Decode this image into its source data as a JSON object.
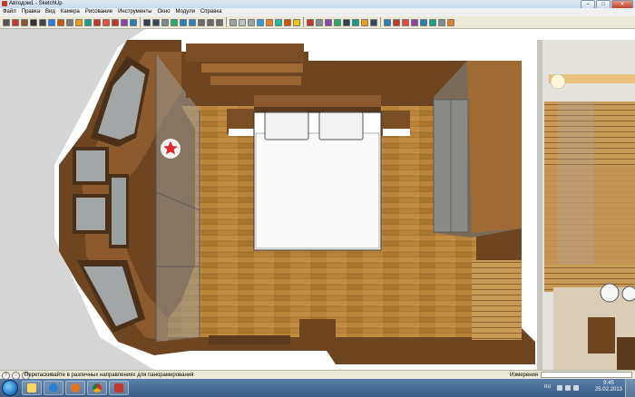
{
  "window": {
    "title": "Автодом1 - SketchUp"
  },
  "menu": [
    "Файл",
    "Правка",
    "Вид",
    "Камера",
    "Рисование",
    "Инструменты",
    "Окно",
    "Модули",
    "Справка"
  ],
  "toolbar": {
    "tools": [
      "select",
      "pencil",
      "rectangle",
      "circle",
      "arc",
      "make-component",
      "eraser",
      "tape",
      "paint",
      "push-pull",
      "move",
      "rotate",
      "scale",
      "follow-me",
      "offset",
      "orbit",
      "pan",
      "zoom",
      "zoom-extents",
      "previous",
      "next",
      "position-camera",
      "walk",
      "look-around",
      "section",
      "xray",
      "back-edges",
      "wireframe",
      "hidden-line",
      "shaded",
      "textured",
      "monochrome",
      "top",
      "front",
      "right",
      "back",
      "left",
      "iso",
      "shadows",
      "fog",
      "get-models",
      "share-model",
      "components",
      "styles",
      "help",
      "info",
      "layers",
      "scenes"
    ]
  },
  "status": {
    "hint": "Перетаскивайте в различных направлениях для панорамирования",
    "measure_label": "Измерения",
    "measure_value": ""
  },
  "taskbar": {
    "lang": "RU",
    "time": "9:45",
    "date": "25.02.2013",
    "apps": [
      "explorer",
      "media-player",
      "firefox",
      "chrome",
      "sketchup"
    ]
  },
  "colors": {
    "wood_floor": "#b9843a",
    "wall": "#7a4e25",
    "glass": "#9fa3a3",
    "bed": "#ffffff",
    "marker": "#e4262b"
  }
}
